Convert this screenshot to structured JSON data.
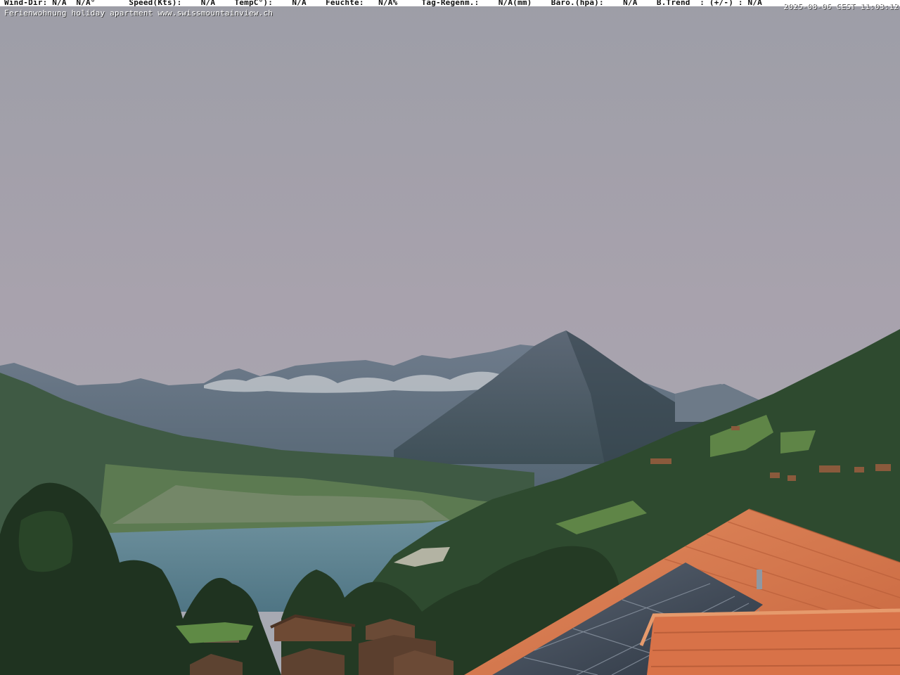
{
  "overlay": {
    "weather_line": "Wind-Dir: N/A  N/A°       Speed(Kts):    N/A    TempC°):    N/A    Feuchte:   N/A%     Tag-Regenm.:    N/A(mm)    Baro.(hpa):    N/A    B.Trend  : (+/-) : N/A",
    "caption": "Ferienwohnung holiday apartment www.swissmountainview.ch",
    "timestamp": "2025-08-06 CEST 11:03:12"
  },
  "colors": {
    "sky_top": "#9b9ca6",
    "sky_bottom": "#a9a3b0",
    "lake": "#5a8290",
    "roof_tiles": "#d9774c",
    "solar_panels": "#3c4654",
    "forest": "#2f4a2e"
  }
}
